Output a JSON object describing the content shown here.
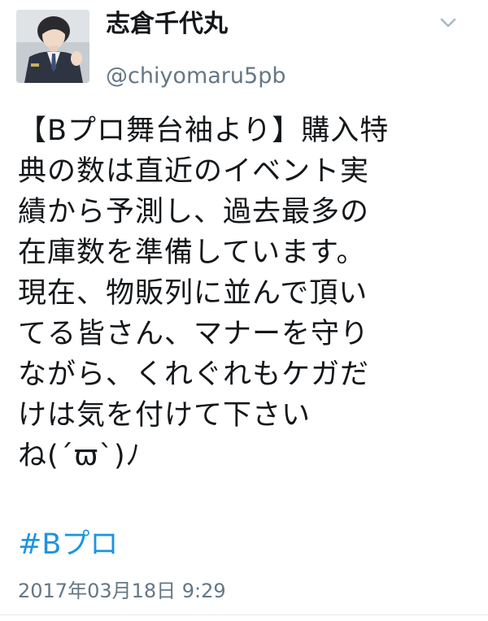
{
  "tweet": {
    "author": {
      "display_name": "志倉千代丸",
      "handle": "@chiyomaru5pb",
      "avatar_icon": "avatar-photo"
    },
    "menu_icon": "chevron-down-icon",
    "text": "【Bプロ舞台袖より】購入特\n典の数は直近のイベント実\n績から予測し、過去最多の\n在庫数を準備しています。\n現在、物販列に並んで頂い\nてる皆さん、マナーを守り\nながら、くれぐれもケガだ\nけは気を付けて下さい\nね(´ϖ`)ﾉ",
    "hashtag": "#Bプロ",
    "timestamp": "2017年03月18日 9:29",
    "colors": {
      "text": "#14171a",
      "secondary": "#657786",
      "link": "#1b95e0"
    }
  }
}
